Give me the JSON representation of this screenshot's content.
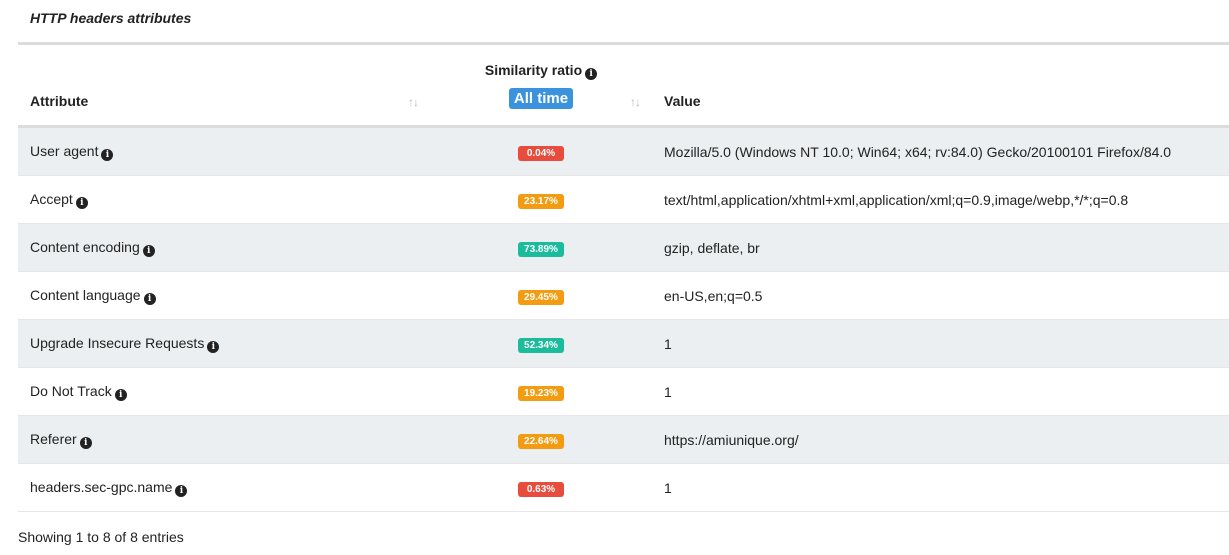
{
  "section": {
    "title": "HTTP headers attributes"
  },
  "table": {
    "headers": {
      "attribute": "Attribute",
      "similarity": "Similarity ratio",
      "similarity_filter": "All time",
      "value": "Value"
    },
    "rows": [
      {
        "attribute": "User agent",
        "ratio": "0.04%",
        "level": "red",
        "value": "Mozilla/5.0 (Windows NT 10.0; Win64; x64; rv:84.0) Gecko/20100101 Firefox/84.0"
      },
      {
        "attribute": "Accept",
        "ratio": "23.17%",
        "level": "orange",
        "value": "text/html,application/xhtml+xml,application/xml;q=0.9,image/webp,*/*;q=0.8"
      },
      {
        "attribute": "Content encoding",
        "ratio": "73.89%",
        "level": "green",
        "value": "gzip, deflate, br"
      },
      {
        "attribute": "Content language",
        "ratio": "29.45%",
        "level": "orange",
        "value": "en-US,en;q=0.5"
      },
      {
        "attribute": "Upgrade Insecure Requests",
        "ratio": "52.34%",
        "level": "green",
        "value": "1"
      },
      {
        "attribute": "Do Not Track",
        "ratio": "19.23%",
        "level": "orange",
        "value": "1"
      },
      {
        "attribute": "Referer",
        "ratio": "22.64%",
        "level": "orange",
        "value": "https://amiunique.org/"
      },
      {
        "attribute": "headers.sec-gpc.name",
        "ratio": "0.63%",
        "level": "red",
        "value": "1"
      }
    ]
  },
  "footer": {
    "entries_text": "Showing 1 to 8 of 8 entries"
  },
  "colors": {
    "red": "#e74c3c",
    "orange": "#f39c12",
    "green": "#1abc9c",
    "accent": "#3a93dc"
  },
  "icons": {
    "info": "info-circle-icon",
    "sort": "sort-arrows-icon"
  }
}
